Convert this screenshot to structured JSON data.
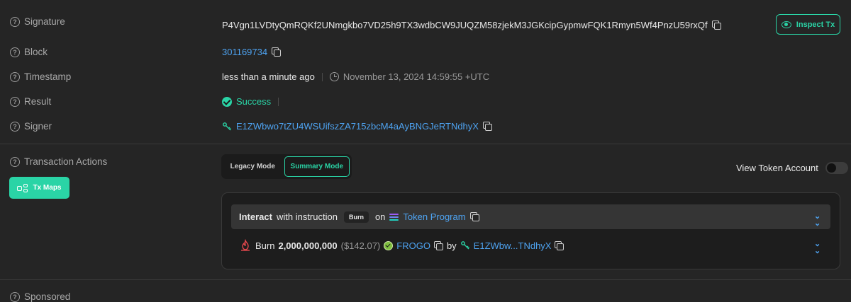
{
  "rows": {
    "signature": {
      "label": "Signature",
      "value": "P4Vgn1LVDtyQmRQKf2UNmgkbo7VD25h9TX3wdbCW9JUQZM58zjekM3JGKcipGypmwFQK1Rmyn5Wf4PnzU59rxQf"
    },
    "block": {
      "label": "Block",
      "value": "301169734"
    },
    "timestamp": {
      "label": "Timestamp",
      "relative": "less than a minute ago",
      "absolute": "November 13, 2024 14:59:55 +UTC"
    },
    "result": {
      "label": "Result",
      "value": "Success"
    },
    "signer": {
      "label": "Signer",
      "value": "E1ZWbwo7tZU4WSUifszZA715zbcM4aAyBNGJeRTNdhyX"
    },
    "actions": {
      "label": "Transaction Actions"
    },
    "sponsored": {
      "label": "Sponsored"
    }
  },
  "buttons": {
    "inspect_tx": "Inspect Tx",
    "tx_maps": "Tx Maps",
    "legacy_mode": "Legacy Mode",
    "summary_mode": "Summary Mode",
    "view_token_account": "View Token Account"
  },
  "instruction": {
    "interact": "Interact",
    "with_instruction": "with instruction",
    "chip": "Burn",
    "on": "on",
    "program": "Token Program"
  },
  "burn": {
    "verb": "Burn",
    "amount": "2,000,000,000",
    "usd": "($142.07)",
    "token": "FROGO",
    "by": "by",
    "account": "E1ZWbw...TNdhyX"
  },
  "colors": {
    "accent": "#2ad4a6",
    "link": "#4ea3f1",
    "background": "#252525"
  },
  "icons": [
    "question-icon",
    "copy-icon",
    "eye-icon",
    "clock-icon",
    "success-icon",
    "signer-icon",
    "nodes-icon",
    "solana-icon",
    "chevron-double-down-icon",
    "fire-icon",
    "frogo-token-icon"
  ]
}
